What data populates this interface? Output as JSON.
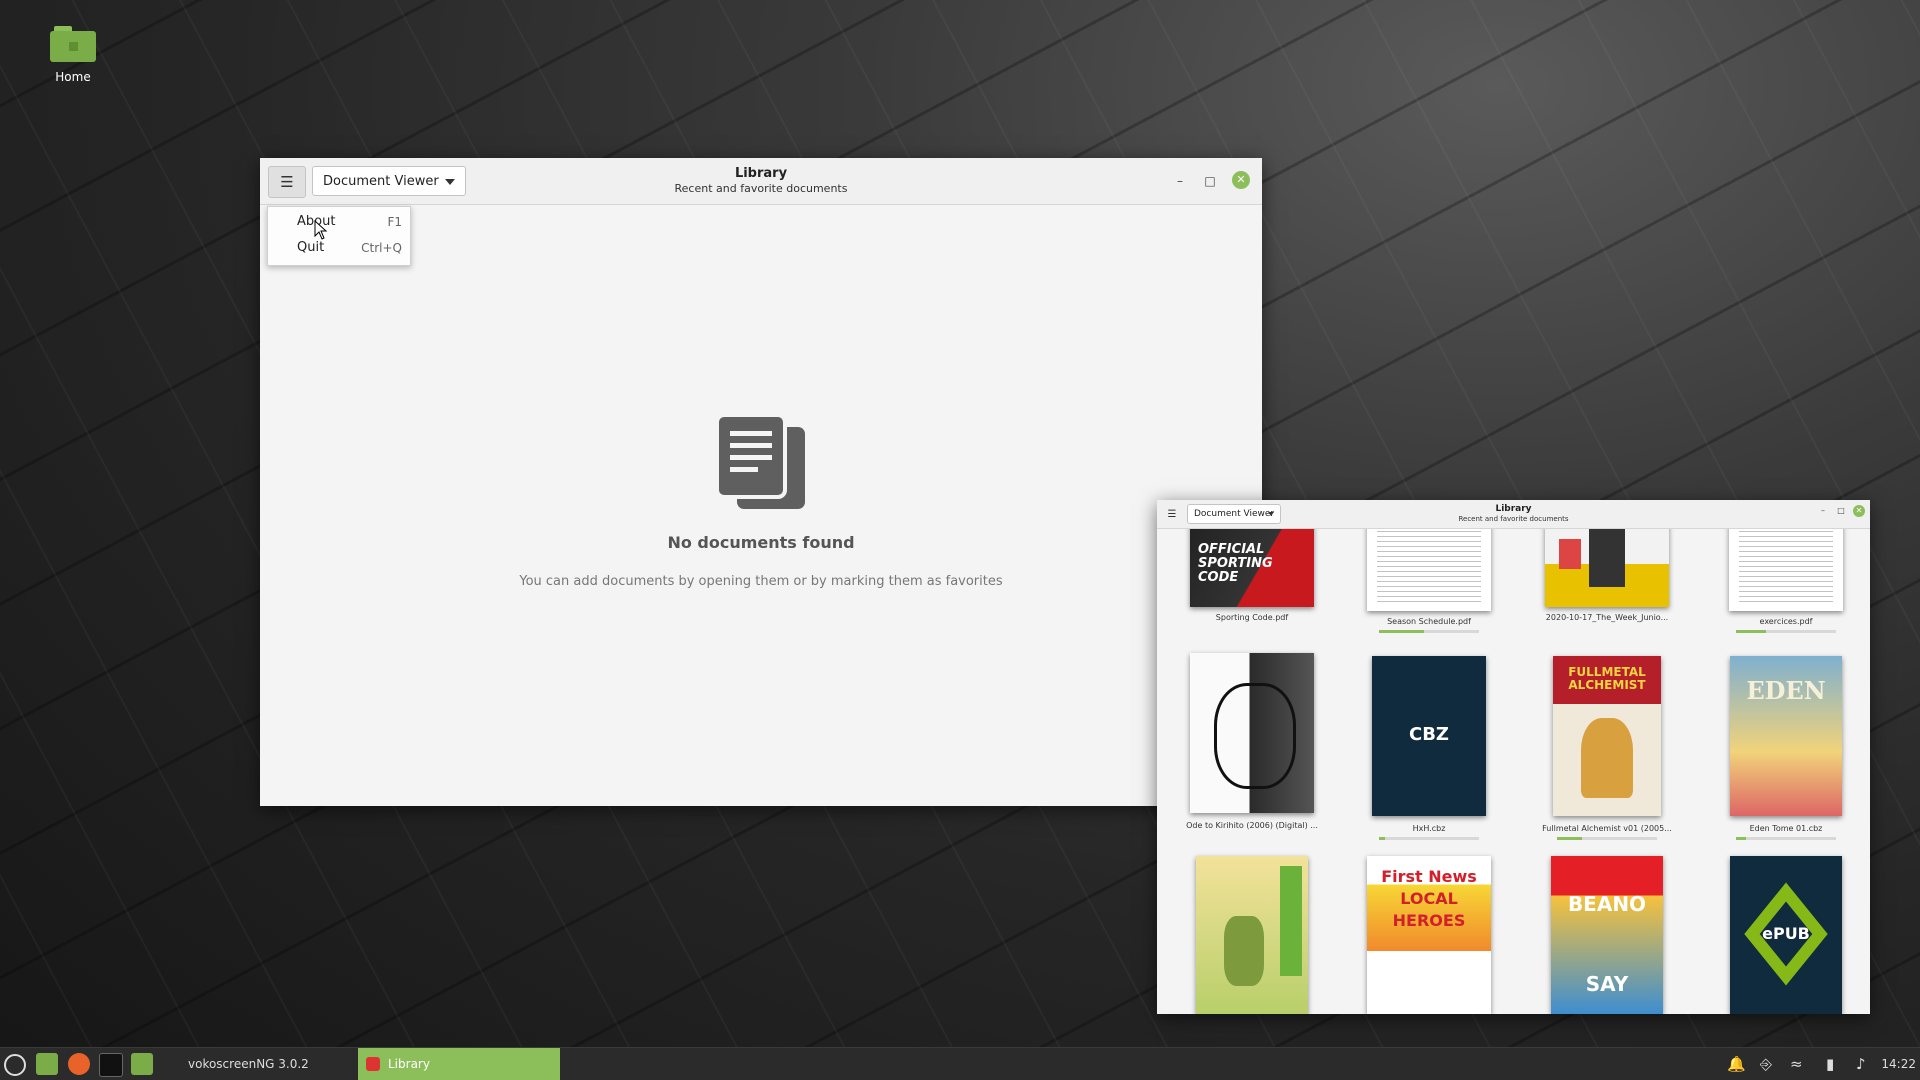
{
  "desktop": {
    "home_label": "Home"
  },
  "main_window": {
    "app_selector": "Document Viewer",
    "title": "Library",
    "subtitle": "Recent and favorite documents",
    "empty_heading": "No documents found",
    "empty_sub": "You can add documents by opening them or by marking them as favorites"
  },
  "menu": {
    "items": [
      {
        "label": "About",
        "accel": "F1"
      },
      {
        "label": "Quit",
        "accel": "Ctrl+Q"
      }
    ]
  },
  "side_window": {
    "app_selector": "Document Viewer",
    "title": "Library",
    "subtitle": "Recent and favorite documents",
    "documents": [
      {
        "name": "Sporting Code.pdf",
        "cover_text": "OFFICIAL SPORTING CODE",
        "progress": 0
      },
      {
        "name": "Season Schedule.pdf",
        "cover_text": "",
        "progress": 0.45
      },
      {
        "name": "2020-10-17_The_Week_Junio...",
        "cover_text": "",
        "progress": 0
      },
      {
        "name": "exercices.pdf",
        "cover_text": "",
        "progress": 0.3
      },
      {
        "name": "Ode to Kirihito (2006) (Digital) ...",
        "cover_text": "",
        "progress": 0
      },
      {
        "name": "HxH.cbz",
        "cover_text": "CBZ",
        "progress": 0.06
      },
      {
        "name": "Fullmetal Alchemist v01 (2005...",
        "cover_text": "FULLMETAL ALCHEMIST",
        "progress": 0.25
      },
      {
        "name": "Eden Tome 01.cbz",
        "cover_text": "EDEN",
        "progress": 0.1
      },
      {
        "name": "",
        "cover_text": "",
        "progress": 0
      },
      {
        "name": "",
        "cover_text": "First News LOCAL HEROES",
        "progress": 0
      },
      {
        "name": "",
        "cover_text": "BEANO SAY CHEESE!",
        "progress": 0
      },
      {
        "name": "",
        "cover_text": "ePUB",
        "progress": 0
      }
    ]
  },
  "taskbar": {
    "tasks": [
      {
        "label": "vokoscreenNG 3.0.2"
      },
      {
        "label": "Library"
      }
    ],
    "clock": "14:22"
  },
  "colors": {
    "accent": "#8cbf5a",
    "taskbar": "#2b2b2b",
    "window_bg": "#f4f4f4"
  }
}
